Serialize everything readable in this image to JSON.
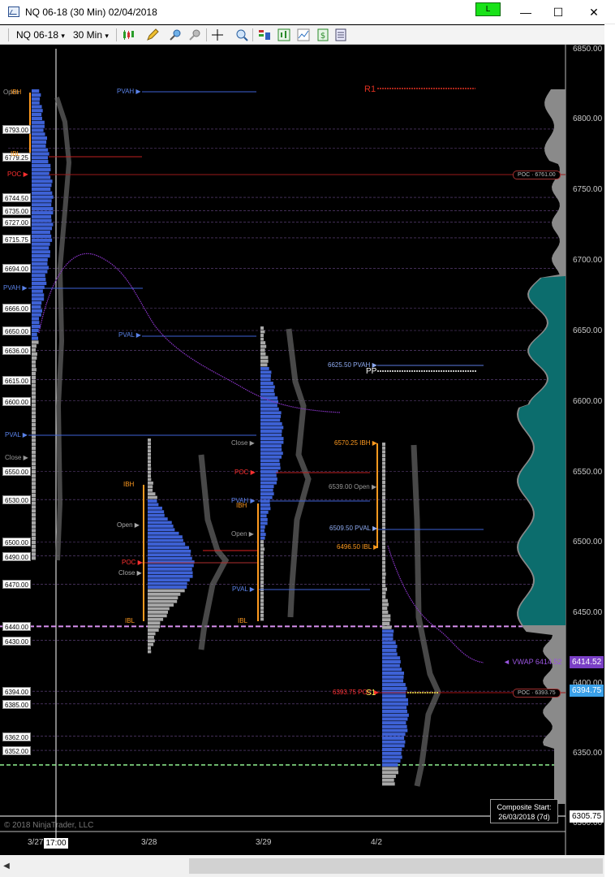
{
  "window": {
    "title": "NQ 06-18 (30 Min)  02/04/2018",
    "link_label": "L",
    "minimize_glyph": "—",
    "maximize_glyph": "☐",
    "close_glyph": "✕"
  },
  "toolbar": {
    "instrument": "NQ 06-18",
    "interval": "30 Min",
    "dropdown_glyph": "▾",
    "icons": [
      "chart-style-icon",
      "drawing-tool-icon",
      "zoom-in-icon",
      "zoom-out-icon",
      "crosshair-icon",
      "magnify-icon",
      "indicators-icon",
      "strategies-icon",
      "data-series-icon",
      "chart-trader-icon",
      "properties-icon"
    ]
  },
  "price_axis": {
    "ticks": [
      "6850.00",
      "6800.00",
      "6750.00",
      "6700.00",
      "6650.00",
      "6600.00",
      "6550.00",
      "6500.00",
      "6450.00",
      "6400.00",
      "6350.00",
      "6300.00"
    ],
    "vwap_tag": "6414.52",
    "last_tag": "6394.75",
    "low_tag": "6305.75"
  },
  "date_axis": {
    "labels": [
      "3/27",
      "3/28",
      "3/29",
      "4/2"
    ],
    "crosshair_time": "17:00"
  },
  "left_price_boxes": [
    "6793.00",
    "6779.25",
    "6744.50",
    "6735.00",
    "6727.00",
    "6715.75",
    "6694.00",
    "6666.00",
    "6650.00",
    "6636.00",
    "6615.00",
    "6600.00",
    "6550.00",
    "6530.00",
    "6500.00",
    "6490.00",
    "6470.00",
    "6440.00",
    "6430.00",
    "6394.00",
    "6385.00",
    "6362.00",
    "6352.00"
  ],
  "session_labels": {
    "s1_open": "Open",
    "s1_ibh": "IBH",
    "s1_ibl": "IBL",
    "s1_poc": "POC",
    "s1_pvah": "PVAH",
    "s1_pval": "PVAL",
    "s1_close": "Close",
    "s1_pvah_right": "PVAH",
    "s2_ibh": "IBH",
    "s2_open": "Open",
    "s2_poc": "POC",
    "s2_close": "Close",
    "s2_ibl": "IBL",
    "s2_pval_top": "PVAL",
    "s3_close": "Close",
    "s3_poc": "POC",
    "s3_pvah": "PVAH",
    "s3_ibh": "IBH",
    "s3_open": "Open",
    "s3_pval": "PVAL",
    "s3_ibl": "IBL",
    "s4_ibh": "6570.25 IBH",
    "s4_open": "6539.00 Open",
    "s4_pval": "6509.50 PVAL",
    "s4_ibl": "6496.50 IBL",
    "s4_pvah": "6625.50 PVAH",
    "s4_poc": "6393.75 POC",
    "pivot_r1": "R1",
    "pivot_pp": "PP",
    "pivot_s1": "S1",
    "vwap": "◄ VWAP  6414.52",
    "poc_tag_top": "POC · 6761.00",
    "poc_tag_bottom": "POC · 6393.75"
  },
  "composite": {
    "line1": "Composite Start:",
    "line2": "26/03/2018 (7d)"
  },
  "copyright": "© 2018 NinjaTrader, LLC",
  "colors": {
    "profile_value_area": "#3e62d6",
    "profile_outside": "#a8a8a8",
    "ib_bar": "#ff9a1f",
    "poc": "#e02020",
    "vwap": "#8a35c8",
    "composite_teal": "#0c6d6d"
  }
}
